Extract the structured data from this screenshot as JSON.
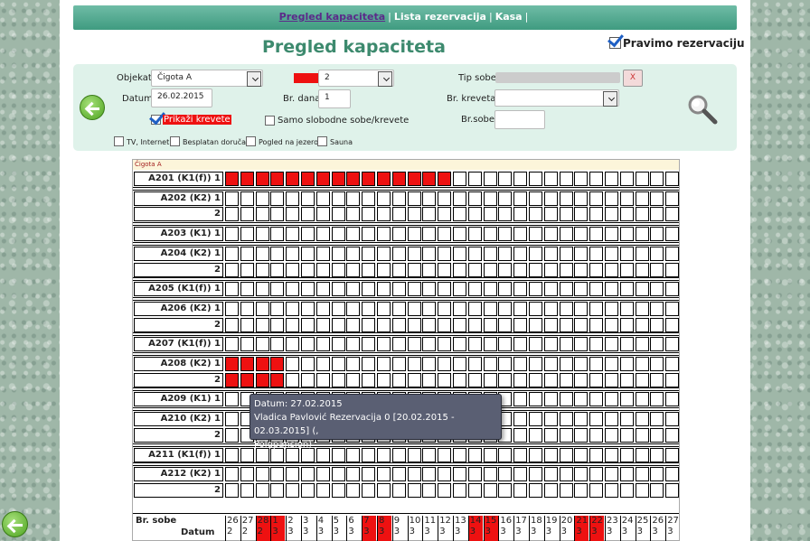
{
  "nav": {
    "items": [
      "Pregled kapaciteta",
      "Lista rezervacija",
      "Kasa"
    ],
    "separator": "|"
  },
  "title": "Pregled kapaciteta",
  "pravimo": {
    "label": "Pravimo rezervaciju",
    "checked": true
  },
  "filters": {
    "objekat": {
      "label": "Objekat",
      "value": "Čigota A"
    },
    "sprat": {
      "label": "Sprat",
      "value": "2"
    },
    "tip_sobe": {
      "label": "Tip sobe",
      "value": "",
      "clear": "X"
    },
    "datum": {
      "label": "Datum",
      "value": "26.02.2015"
    },
    "br_dana": {
      "label": "Br. dana",
      "value": "1"
    },
    "br_kreveta": {
      "label": "Br. kreveta",
      "value": ""
    },
    "prikazi": {
      "label": "Prikaži krevete",
      "checked": true
    },
    "samo": {
      "label": "Samo slobodne sobe/krevete",
      "checked": false
    },
    "br_sobe": {
      "label": "Br.sobe",
      "value": ""
    },
    "features": [
      "TV, Internet",
      "Besplatan doručak",
      "Pogled na jezero",
      "Sauna"
    ]
  },
  "hotel": "Čigota A",
  "rooms": [
    {
      "name": "A201 (K1(f))",
      "beds": [
        {
          "no": "1",
          "red": [
            0,
            1,
            2,
            3,
            4,
            5,
            6,
            7,
            8,
            9,
            10,
            11,
            12,
            13,
            14
          ]
        }
      ]
    },
    {
      "name": "A202 (K2)",
      "beds": [
        {
          "no": "1",
          "red": []
        },
        {
          "no": "2",
          "red": []
        }
      ]
    },
    {
      "name": "A203 (K1)",
      "beds": [
        {
          "no": "1",
          "red": []
        }
      ]
    },
    {
      "name": "A204 (K2)",
      "beds": [
        {
          "no": "1",
          "red": []
        },
        {
          "no": "2",
          "red": []
        }
      ]
    },
    {
      "name": "A205 (K1(f))",
      "beds": [
        {
          "no": "1",
          "red": []
        }
      ]
    },
    {
      "name": "A206 (K2)",
      "beds": [
        {
          "no": "1",
          "red": []
        },
        {
          "no": "2",
          "red": []
        }
      ]
    },
    {
      "name": "A207 (K1(f))",
      "beds": [
        {
          "no": "1",
          "red": []
        }
      ]
    },
    {
      "name": "A208 (K2)",
      "beds": [
        {
          "no": "1",
          "red": [
            0,
            1,
            2,
            3
          ]
        },
        {
          "no": "2",
          "red": [
            0,
            1,
            2,
            3
          ]
        }
      ]
    },
    {
      "name": "A209 (K1)",
      "beds": [
        {
          "no": "1",
          "red": []
        }
      ]
    },
    {
      "name": "A210 (K2)",
      "beds": [
        {
          "no": "1",
          "red": []
        },
        {
          "no": "2",
          "red": []
        }
      ]
    },
    {
      "name": "A211 (K1(f))",
      "beds": [
        {
          "no": "1",
          "red": []
        }
      ]
    },
    {
      "name": "A212 (K2)",
      "beds": [
        {
          "no": "1",
          "red": []
        },
        {
          "no": "2",
          "red": []
        }
      ]
    }
  ],
  "footer": {
    "rooms_label": "Br. sobe",
    "date_label": "Datum",
    "days": [
      [
        "26",
        "2",
        0
      ],
      [
        "27",
        "2",
        0
      ],
      [
        "28",
        "2",
        1
      ],
      [
        "1",
        "3",
        1
      ],
      [
        "2",
        "3",
        0
      ],
      [
        "3",
        "3",
        0
      ],
      [
        "4",
        "3",
        0
      ],
      [
        "5",
        "3",
        0
      ],
      [
        "6",
        "3",
        0
      ],
      [
        "7",
        "3",
        1
      ],
      [
        "8",
        "3",
        1
      ],
      [
        "9",
        "3",
        0
      ],
      [
        "10",
        "3",
        0
      ],
      [
        "11",
        "3",
        0
      ],
      [
        "12",
        "3",
        0
      ],
      [
        "13",
        "3",
        0
      ],
      [
        "14",
        "3",
        1
      ],
      [
        "15",
        "3",
        1
      ],
      [
        "16",
        "3",
        0
      ],
      [
        "17",
        "3",
        0
      ],
      [
        "18",
        "3",
        0
      ],
      [
        "19",
        "3",
        0
      ],
      [
        "20",
        "3",
        0
      ],
      [
        "21",
        "3",
        1
      ],
      [
        "22",
        "3",
        1
      ],
      [
        "23",
        "3",
        0
      ],
      [
        "24",
        "3",
        0
      ],
      [
        "25",
        "3",
        0
      ],
      [
        "26",
        "3",
        0
      ],
      [
        "27",
        "3",
        0
      ]
    ]
  },
  "tooltip": {
    "line1": "Datum: 27.02.2015",
    "line2": "Vladica Pavlović Rezervacija 0 [20.02.2015 - 02.03.2015] (,",
    "line3": "Polupansion)"
  },
  "colors": {
    "booked": "#ee1111",
    "accent": "#3d8a6e",
    "panel": "#dff2ea"
  }
}
